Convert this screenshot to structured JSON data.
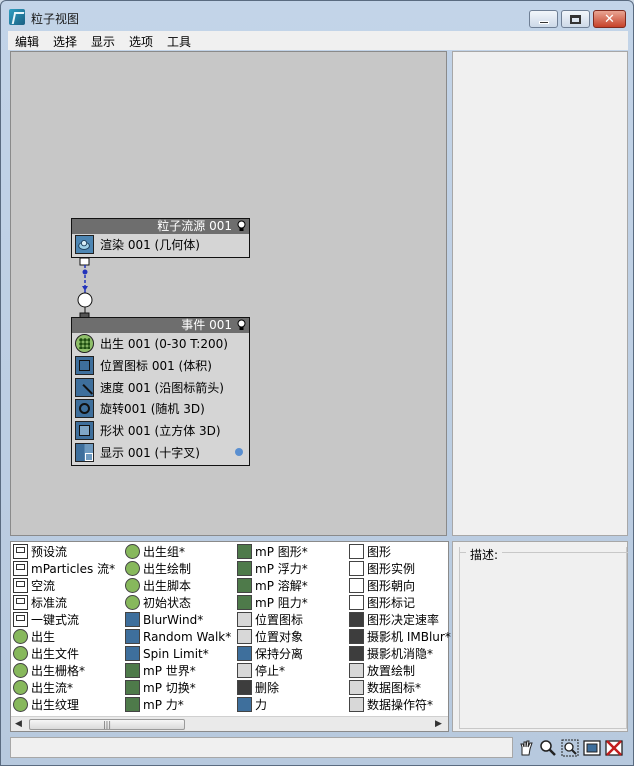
{
  "window": {
    "title": "粒子视图",
    "controls": [
      "minimize",
      "maximize",
      "close"
    ]
  },
  "menu": [
    "编辑",
    "选择",
    "显示",
    "选项",
    "工具"
  ],
  "graph": {
    "source_node": {
      "title": "粒子流源 001",
      "operators": [
        {
          "label": "渲染 001 (几何体)",
          "icon": "render-icon"
        }
      ]
    },
    "event_node": {
      "title": "事件 001",
      "operators": [
        {
          "label": "出生 001 (0-30 T:200)",
          "icon": "birth-icon"
        },
        {
          "label": "位置图标 001 (体积)",
          "icon": "position-icon"
        },
        {
          "label": "速度 001 (沿图标箭头)",
          "icon": "speed-icon"
        },
        {
          "label": "旋转001 (随机 3D)",
          "icon": "rotation-icon"
        },
        {
          "label": "形状 001 (立方体 3D)",
          "icon": "shape-icon"
        },
        {
          "label": "显示 001 (十字叉)",
          "icon": "display-icon"
        }
      ]
    }
  },
  "depot": {
    "columns": [
      [
        "预设流",
        "mParticles 流*",
        "空流",
        "标准流",
        "一键式流",
        "出生",
        "出生文件",
        "出生栅格*",
        "出生流*",
        "出生纹理"
      ],
      [
        "出生组*",
        "出生绘制",
        "出生脚本",
        "初始状态",
        "BlurWind*",
        "Random Walk*",
        "Spin Limit*",
        "mP 世界*",
        "mP 切换*",
        "mP 力*"
      ],
      [
        "mP 图形*",
        "mP 浮力*",
        "mP 溶解*",
        "mP 阻力*",
        "位置图标",
        "位置对象",
        "保持分离",
        "停止*",
        "删除",
        "力"
      ],
      [
        "图形",
        "图形实例",
        "图形朝向",
        "图形标记",
        "图形决定速率",
        "摄影机 IMBlur*",
        "摄影机消隐*",
        "放置绘制",
        "数据图标*",
        "数据操作符*"
      ]
    ]
  },
  "description": {
    "label": "描述:"
  },
  "statusbar": {
    "tools": [
      "pan-icon",
      "zoom-icon",
      "zoom-region-icon",
      "zoom-extents-icon",
      "no-draw-icon"
    ]
  }
}
